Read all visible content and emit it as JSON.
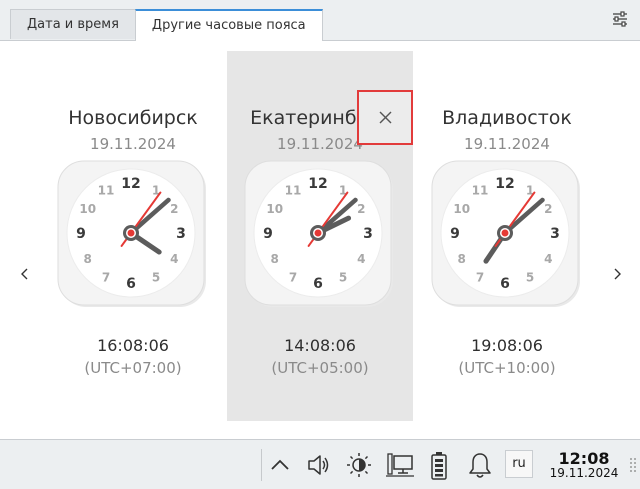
{
  "tabs": [
    {
      "label": "Дата и время",
      "active": false
    },
    {
      "label": "Другие часовые пояса",
      "active": true
    }
  ],
  "cities": [
    {
      "name": "Новосибирск",
      "date": "19.11.2024",
      "time": "16:08:06",
      "offset": "(UTC+07:00)",
      "selected": false
    },
    {
      "name": "Екатеринбург",
      "date": "19.11.2024",
      "time": "14:08:06",
      "offset": "(UTC+05:00)",
      "selected": true
    },
    {
      "name": "Владивосток",
      "date": "19.11.2024",
      "time": "19:08:06",
      "offset": "(UTC+10:00)",
      "selected": false
    }
  ],
  "clock_numbers": [
    "12",
    "1",
    "2",
    "3",
    "4",
    "5",
    "6",
    "7",
    "8",
    "9",
    "10",
    "11"
  ],
  "taskbar": {
    "language": "ru",
    "time": "12:08",
    "date": "19.11.2024"
  },
  "colors": {
    "accent": "#3b8ed8",
    "second_hand": "#e53935",
    "hand": "#5c5c5c",
    "selected_column": "#e6e6e6",
    "highlight_border": "#e23b3b"
  },
  "icons": {
    "settings": "sliders-icon",
    "close": "close-icon",
    "prev": "chevron-left-icon",
    "next": "chevron-right-icon",
    "tray_expand": "chevron-up-icon",
    "volume": "speaker-icon",
    "brightness": "brightness-icon",
    "network": "network-wired-icon",
    "battery": "battery-icon",
    "notifications": "bell-icon"
  }
}
